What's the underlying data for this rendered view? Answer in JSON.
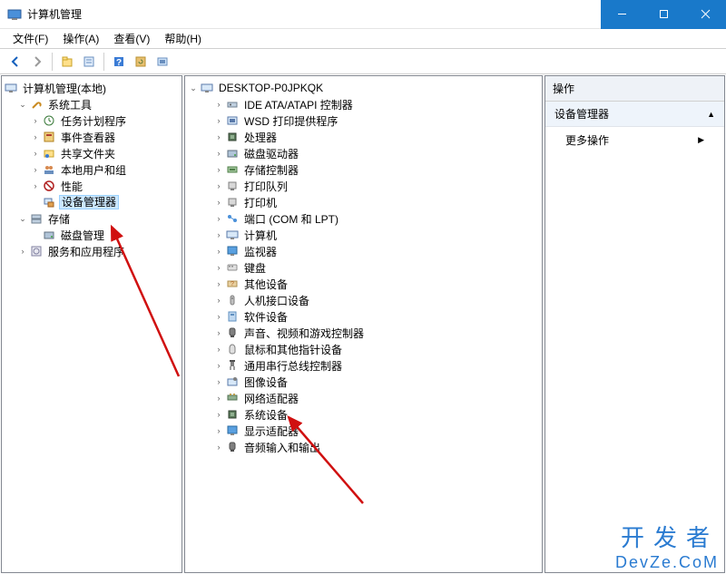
{
  "window": {
    "title": "计算机管理"
  },
  "menu": {
    "file": "文件(F)",
    "action": "操作(A)",
    "view": "查看(V)",
    "help": "帮助(H)"
  },
  "left_tree": {
    "root": "计算机管理(本地)",
    "system_tools": "系统工具",
    "task_scheduler": "任务计划程序",
    "event_viewer": "事件查看器",
    "shared_folders": "共享文件夹",
    "local_users": "本地用户和组",
    "performance": "性能",
    "device_manager": "设备管理器",
    "storage": "存储",
    "disk_mgmt": "磁盘管理",
    "services_apps": "服务和应用程序"
  },
  "device_tree": {
    "root": "DESKTOP-P0JPKQK",
    "items": [
      "IDE ATA/ATAPI 控制器",
      "WSD 打印提供程序",
      "处理器",
      "磁盘驱动器",
      "存储控制器",
      "打印队列",
      "打印机",
      "端口 (COM 和 LPT)",
      "计算机",
      "监视器",
      "键盘",
      "其他设备",
      "人机接口设备",
      "软件设备",
      "声音、视频和游戏控制器",
      "鼠标和其他指针设备",
      "通用串行总线控制器",
      "图像设备",
      "网络适配器",
      "系统设备",
      "显示适配器",
      "音频输入和输出"
    ]
  },
  "actions": {
    "header": "操作",
    "subheader": "设备管理器",
    "more": "更多操作"
  },
  "watermark": {
    "cn": "开发者",
    "en": "DevZe.CoM"
  }
}
